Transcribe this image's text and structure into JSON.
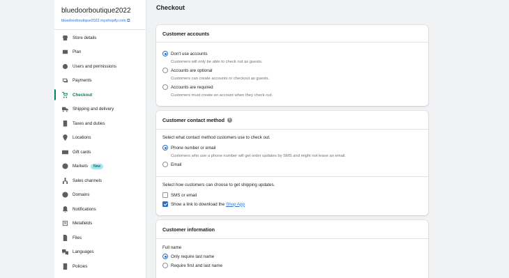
{
  "store": {
    "name": "bluedoorboutique2022",
    "url": "bluedoorboutique2022.myshopify.com"
  },
  "sidebar": {
    "items": [
      {
        "label": "Store details",
        "icon": "store-icon"
      },
      {
        "label": "Plan",
        "icon": "plan-icon"
      },
      {
        "label": "Users and permissions",
        "icon": "user-icon"
      },
      {
        "label": "Payments",
        "icon": "payments-icon"
      },
      {
        "label": "Checkout",
        "icon": "cart-icon",
        "active": true
      },
      {
        "label": "Shipping and delivery",
        "icon": "truck-icon"
      },
      {
        "label": "Taxes and duties",
        "icon": "taxes-icon"
      },
      {
        "label": "Locations",
        "icon": "location-pin-icon"
      },
      {
        "label": "Gift cards",
        "icon": "gift-card-icon"
      },
      {
        "label": "Markets",
        "icon": "globe-icon",
        "badge": "New"
      },
      {
        "label": "Sales channels",
        "icon": "sales-channels-icon"
      },
      {
        "label": "Domains",
        "icon": "domains-globe-icon"
      },
      {
        "label": "Notifications",
        "icon": "bell-icon"
      },
      {
        "label": "Metafields",
        "icon": "metafields-icon"
      },
      {
        "label": "Files",
        "icon": "files-icon"
      },
      {
        "label": "Languages",
        "icon": "languages-icon"
      },
      {
        "label": "Policies",
        "icon": "policies-icon"
      }
    ]
  },
  "page": {
    "title": "Checkout"
  },
  "customer_accounts": {
    "title": "Customer accounts",
    "options": [
      {
        "label": "Don't use accounts",
        "help": "Customers will only be able to check out as guests.",
        "selected": true
      },
      {
        "label": "Accounts are optional",
        "help": "Customers can create accounts or checkout as guests.",
        "selected": false
      },
      {
        "label": "Accounts are required",
        "help": "Customers must create an account when they check out.",
        "selected": false
      }
    ]
  },
  "contact_method": {
    "title": "Customer contact method",
    "intro": "Select what contact method customers use to check out.",
    "options": [
      {
        "label": "Phone number or email",
        "help": "Customers who use a phone number will get order updates by SMS and might not leave an email.",
        "selected": true
      },
      {
        "label": "Email",
        "selected": false
      }
    ],
    "updates_intro": "Select how customers can choose to get shipping updates.",
    "updates": [
      {
        "label": "SMS or email",
        "checked": false
      },
      {
        "label": "Show a link to download the",
        "link": "Shop App",
        "checked": true
      }
    ]
  },
  "customer_information": {
    "title": "Customer information",
    "full_name_label": "Full name",
    "options": [
      {
        "label": "Only require last name",
        "selected": true
      },
      {
        "label": "Require first and last name",
        "selected": false
      }
    ]
  },
  "colors": {
    "accent": "#008060",
    "link": "#2c6ecb",
    "badge_bg": "#a4e8f2"
  }
}
